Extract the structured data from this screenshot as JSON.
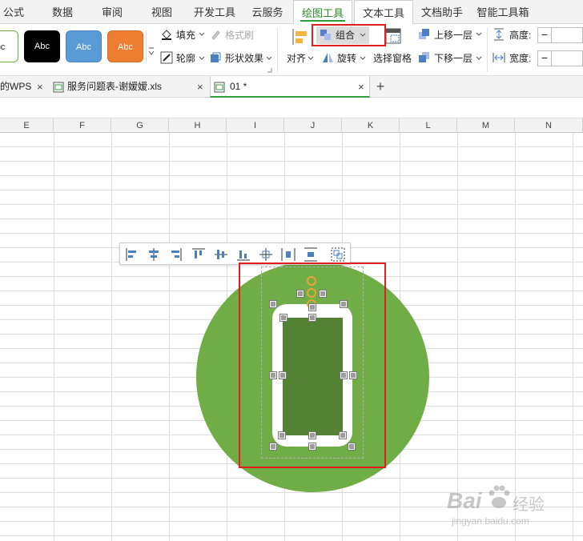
{
  "ribbon": {
    "tabs": [
      "公式",
      "数据",
      "审阅",
      "视图",
      "开发工具",
      "云服务",
      "绘图工具",
      "文本工具",
      "文档助手",
      "智能工具箱"
    ],
    "active_tab": "绘图工具"
  },
  "toolbar": {
    "styles": [
      {
        "label": "bc",
        "bg": "#ffffff",
        "fg": "#222222",
        "border": "#70ad47"
      },
      {
        "label": "Abc",
        "bg": "#000000",
        "fg": "#ffffff",
        "border": "#000000"
      },
      {
        "label": "Abc",
        "bg": "#5b9bd5",
        "fg": "#ffffff",
        "border": "#4a86c0"
      },
      {
        "label": "Abc",
        "bg": "#ed7d31",
        "fg": "#ffffff",
        "border": "#d66b22"
      }
    ],
    "fill": "填充",
    "format_brush": "格式刷",
    "outline": "轮廓",
    "shape_effect": "形状效果",
    "align": "对齐",
    "group": "组合",
    "rotate": "旋转",
    "select_pane": "选择窗格",
    "bring_forward": "上移一层",
    "send_backward": "下移一层",
    "height_label": "高度:",
    "width_label": "宽度:",
    "minus": "−"
  },
  "doc_tabs": [
    {
      "label": "的WPS",
      "active": false
    },
    {
      "label": "服务问题表-谢嫒嫒.xls",
      "active": false
    },
    {
      "label": "01 *",
      "active": true
    }
  ],
  "add_tab": "+",
  "columns": [
    "E",
    "F",
    "G",
    "H",
    "I",
    "J",
    "K",
    "L",
    "M",
    "N"
  ],
  "watermark": {
    "brand": "Bai",
    "brand2": "经验",
    "url": "jingyan.baidu.com"
  },
  "colors": {
    "accent": "#2e9e3e",
    "circle": "#70ad47",
    "inner": "#548235",
    "highlight": "#e02020"
  }
}
